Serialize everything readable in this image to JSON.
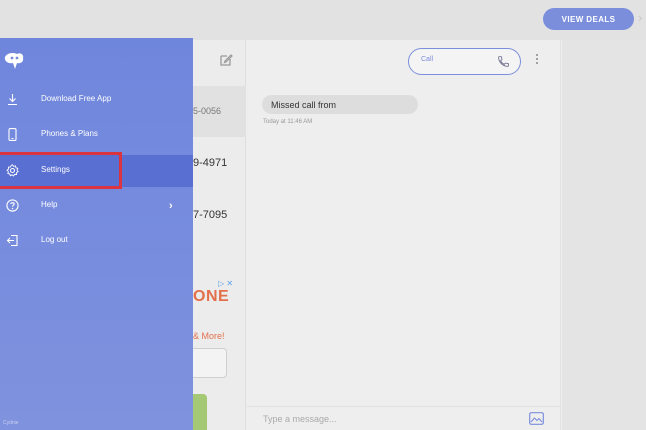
{
  "topbar": {
    "view_deals_label": "VIEW DEALS",
    "close_glyph": "›"
  },
  "contacts": {
    "numbers": [
      "5-0056",
      "9-4971",
      "7-7095"
    ]
  },
  "ad": {
    "badge": "▷ ✕",
    "headline": "ONE",
    "more": "& More!"
  },
  "chat": {
    "call_label": "Call",
    "message_text": "Missed call from",
    "message_time": "Today at 11:46 AM",
    "input_placeholder": "Type a message..."
  },
  "drawer": {
    "items": [
      {
        "label": "Download Free App",
        "icon": "download-icon"
      },
      {
        "label": "Phones & Plans",
        "icon": "phone-device-icon"
      },
      {
        "label": "Settings",
        "icon": "gear-icon",
        "selected": true
      },
      {
        "label": "Help",
        "icon": "help-icon"
      },
      {
        "label": "Log out",
        "icon": "logout-icon"
      }
    ],
    "footer": "Cydnie"
  },
  "colors": {
    "accent": "#7b8edc",
    "drawer": "#6f86dd",
    "highlight": "#d9343f",
    "ad_text": "#e3704b"
  }
}
